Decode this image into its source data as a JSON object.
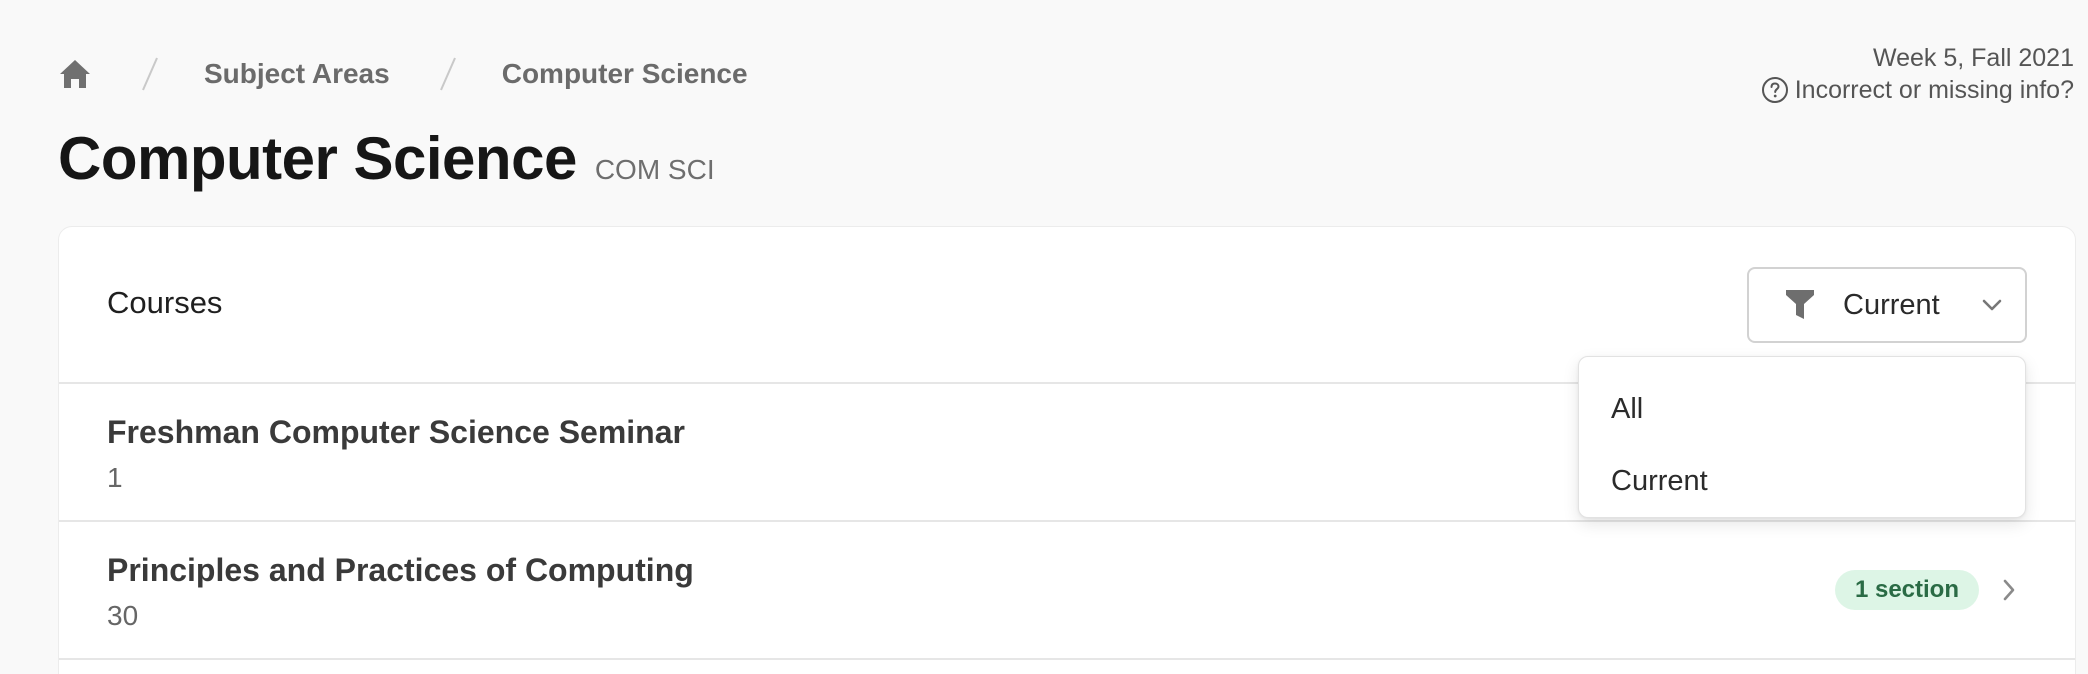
{
  "breadcrumb": {
    "home_icon": "home-icon",
    "items": [
      {
        "label": "Subject Areas"
      },
      {
        "label": "Computer Science"
      }
    ]
  },
  "info": {
    "term": "Week 5, Fall 2021",
    "report_label": "Incorrect or missing info?",
    "report_icon": "question-circle-icon"
  },
  "page": {
    "title": "Computer Science",
    "code": "COM SCI"
  },
  "courses_card": {
    "title": "Courses",
    "filter": {
      "selected": "Current",
      "icon": "funnel-icon",
      "options": [
        "All",
        "Current"
      ]
    },
    "rows": [
      {
        "name": "Freshman Computer Science Seminar",
        "number": "1",
        "badge": ""
      },
      {
        "name": "Principles and Practices of Computing",
        "number": "30",
        "badge": "1 section"
      }
    ]
  },
  "colors": {
    "background": "#f9f9f9",
    "card": "#ffffff",
    "badge_bg": "#ddf5e6",
    "badge_text": "#2a6b45"
  }
}
